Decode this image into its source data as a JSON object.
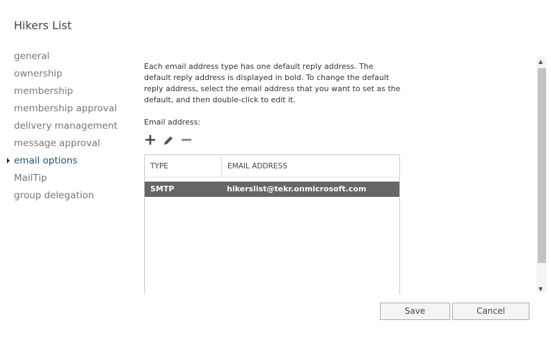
{
  "title": "Hikers List",
  "nav": [
    "general",
    "ownership",
    "membership",
    "membership approval",
    "delivery management",
    "message approval",
    "email options",
    "MailTip",
    "group delegation"
  ],
  "description": "Each email address type has one default reply address. The default reply address is displayed in bold. To change the default reply address, select the email address that you want to set as the default, and then double-click to edit it.",
  "email_label": "Email address:",
  "table": {
    "headers": [
      "TYPE",
      "EMAIL ADDRESS"
    ],
    "rows": [
      {
        "type": "SMTP",
        "address": "hikerslist@tekr.onmicrosoft.com"
      }
    ]
  },
  "buttons": {
    "save": "Save",
    "cancel": "Cancel"
  }
}
